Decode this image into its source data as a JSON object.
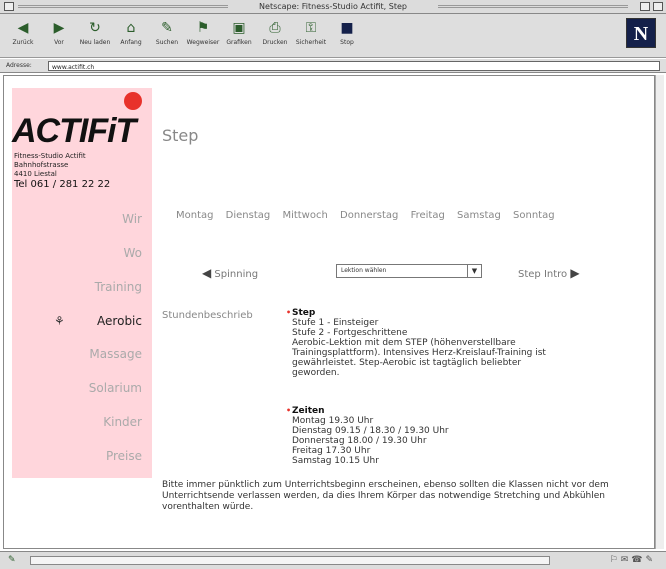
{
  "window": {
    "title": "Netscape: Fitness-Studio Actifit, Step"
  },
  "toolbar": {
    "buttons": [
      {
        "label": "Zurück",
        "icon": "back-icon"
      },
      {
        "label": "Vor",
        "icon": "forward-icon"
      },
      {
        "label": "Neu laden",
        "icon": "reload-icon"
      },
      {
        "label": "Anfang",
        "icon": "home-icon"
      },
      {
        "label": "Suchen",
        "icon": "search-icon"
      },
      {
        "label": "Wegweiser",
        "icon": "guide-icon"
      },
      {
        "label": "Grafiken",
        "icon": "images-icon"
      },
      {
        "label": "Drucken",
        "icon": "print-icon"
      },
      {
        "label": "Sicherheit",
        "icon": "security-icon"
      },
      {
        "label": "Stop",
        "icon": "stop-icon"
      }
    ],
    "brand_letter": "N"
  },
  "location": {
    "label": "Adresse:",
    "value": "www.actifit.ch"
  },
  "sidebar": {
    "logo": "ACTIFiT",
    "address_lines": [
      "Fitness-Studio Actifit",
      "Bahnhofstrasse",
      "4410 Liestal"
    ],
    "tel": "Tel 061 / 281 22 22",
    "nav": [
      {
        "label": "Wir"
      },
      {
        "label": "Wo"
      },
      {
        "label": "Training"
      },
      {
        "label": "Aerobic"
      },
      {
        "label": "Massage"
      },
      {
        "label": "Solarium"
      },
      {
        "label": "Kinder"
      },
      {
        "label": "Preise"
      }
    ]
  },
  "main": {
    "title": "Step",
    "days": [
      "Montag",
      "Dienstag",
      "Mittwoch",
      "Donnerstag",
      "Freitag",
      "Samstag",
      "Sonntag"
    ],
    "prev_label": "Spinning",
    "next_label": "Step Intro",
    "select_value": "Lektion wählen",
    "section_label": "Stundenbeschrieb",
    "step_head": "Step",
    "step_lines": [
      "Stufe 1 - Einsteiger",
      "Stufe 2 - Fortgeschrittene",
      "Aerobic-Lektion mit dem STEP (höhenverstellbare",
      "Trainingsplattform). Intensives Herz-Kreislauf-Training ist",
      "gewährleistet. Step-Aerobic ist tagtäglich beliebter",
      "geworden."
    ],
    "times_head": "Zeiten",
    "times_lines": [
      "Montag 19.30 Uhr",
      "Dienstag 09.15 / 18.30 / 19.30 Uhr",
      "Donnerstag 18.00 / 19.30 Uhr",
      "Freitag 17.30 Uhr",
      "Samstag 10.15 Uhr"
    ],
    "footer": "Bitte immer pünktlich zum Unterrichtsbeginn erscheinen, ebenso sollten die Klassen nicht vor dem Unterrichtsende verlassen werden, da dies Ihrem Körper das notwendige Stretching und Abkühlen vorenthalten würde."
  }
}
